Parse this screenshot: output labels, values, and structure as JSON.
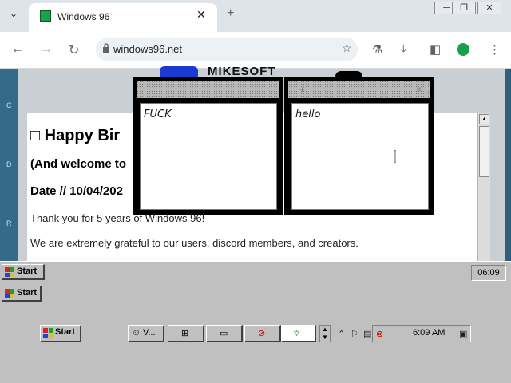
{
  "browser": {
    "tab_title": "Windows 96",
    "tab_close": "✕",
    "new_tab": "+",
    "tab_menu": "⌄",
    "url": "windows96.net",
    "window_controls": [
      "─",
      "❐",
      "✕"
    ]
  },
  "site": {
    "logo_text": "MIKESOFT",
    "side_letters": [
      "C",
      "D",
      "R"
    ],
    "heading": "□ Happy Bir",
    "subheading": "(And welcome to",
    "date": "Date // 10/04/202",
    "paragraph1": "Thank you for 5 years of Windows 96!",
    "paragraph2": "We are extremely grateful to our users, discord members, and creators."
  },
  "notes": [
    {
      "text": "FUCK",
      "buttons": []
    },
    {
      "text": "hello",
      "buttons": [
        "+",
        "×"
      ]
    }
  ],
  "taskbar_top": {
    "start_label": "Start",
    "clock": "06:09"
  },
  "taskbar_mid": {
    "start_label": "Start"
  },
  "taskbar_bottom": {
    "start_label": "Start",
    "tasks": [
      {
        "label": "V...",
        "icon": "user-icon"
      },
      {
        "label": "",
        "icon": "network-icon"
      },
      {
        "label": "",
        "icon": "monitor-icon"
      },
      {
        "label": "",
        "icon": "no-entry-icon"
      },
      {
        "label": "",
        "icon": "gears-icon"
      }
    ],
    "clock": "6:09 AM"
  },
  "colors": {
    "accent": "#1aa04c",
    "page_bg": "#2f5f7d",
    "win_gray": "#c0c0c0"
  }
}
